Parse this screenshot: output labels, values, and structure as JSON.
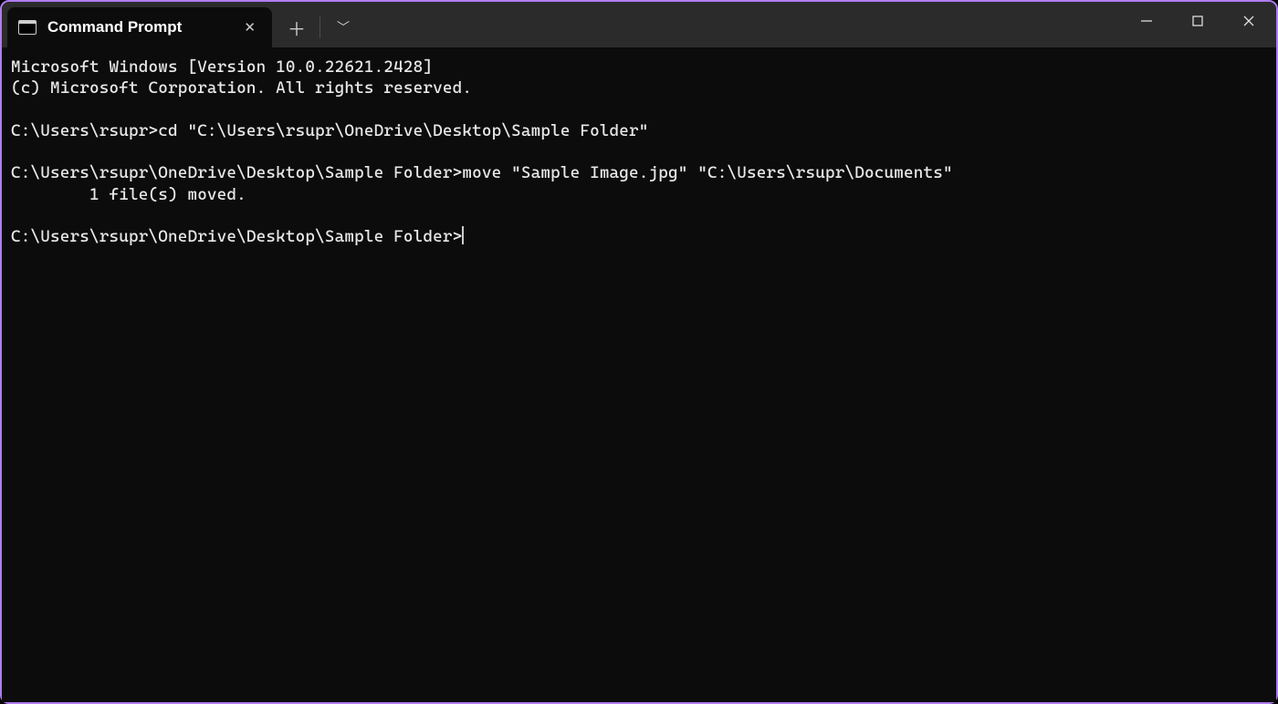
{
  "tab": {
    "title": "Command Prompt"
  },
  "terminal": {
    "line1": "Microsoft Windows [Version 10.0.22621.2428]",
    "line2": "(c) Microsoft Corporation. All rights reserved.",
    "blank1": "",
    "line3_prompt": "C:\\Users\\rsupr>",
    "line3_cmd": "cd \"C:\\Users\\rsupr\\OneDrive\\Desktop\\Sample Folder\"",
    "blank2": "",
    "line4_prompt": "C:\\Users\\rsupr\\OneDrive\\Desktop\\Sample Folder>",
    "line4_cmd": "move \"Sample Image.jpg\" \"C:\\Users\\rsupr\\Documents\"",
    "line5": "        1 file(s) moved.",
    "blank3": "",
    "line6_prompt": "C:\\Users\\rsupr\\OneDrive\\Desktop\\Sample Folder>"
  }
}
